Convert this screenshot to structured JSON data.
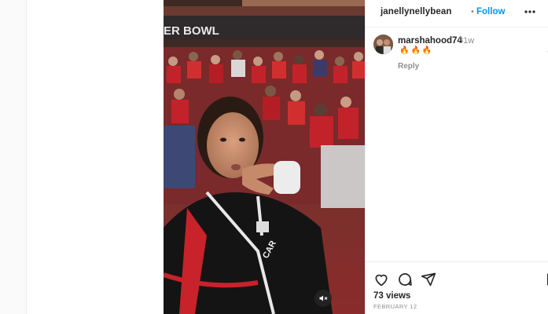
{
  "post": {
    "author": "janellynellybean",
    "separator": "•",
    "follow_label": "Follow",
    "more_icon": "more-horizontal-icon"
  },
  "video": {
    "stadium_text": "ER BOWL",
    "jersey_text": "CAR",
    "mute_icon": "muted-speaker-icon"
  },
  "comments": [
    {
      "user": "marshahood74",
      "time": "31w",
      "text": "🔥🔥🔥",
      "reply_label": "Reply",
      "like_icon": "heart-outline-icon"
    }
  ],
  "actions": {
    "like_icon": "heart-icon",
    "comment_icon": "comment-icon",
    "share_icon": "share-icon",
    "save_icon": "bookmark-icon",
    "views": "73 views",
    "date": "FEBRUARY 12"
  },
  "colors": {
    "accent": "#0095f6",
    "text": "#262626",
    "muted": "#8e8e8e",
    "crowd_red": "#c8222b",
    "jersey": "#141414"
  }
}
